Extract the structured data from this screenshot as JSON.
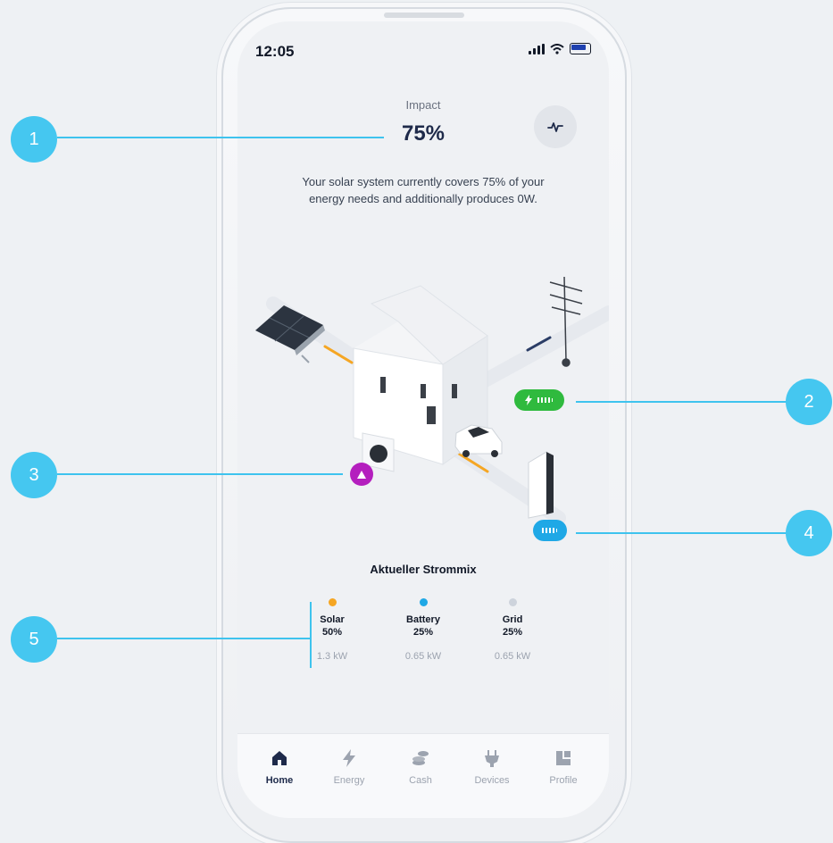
{
  "status": {
    "time": "12:05"
  },
  "impact": {
    "label": "Impact",
    "value": "75%",
    "description": "Your solar system currently covers 75% of your energy needs and additionally produces 0W."
  },
  "mix": {
    "title": "Aktueller Strommix",
    "items": [
      {
        "name": "Solar",
        "percent": "50%",
        "power": "1.3 kW",
        "color": "#f5a623"
      },
      {
        "name": "Battery",
        "percent": "25%",
        "power": "0.65 kW",
        "color": "#1fa8e6"
      },
      {
        "name": "Grid",
        "percent": "25%",
        "power": "0.65 kW",
        "color": "#cdd3dc"
      }
    ]
  },
  "tabs": [
    {
      "label": "Home",
      "icon": "home-icon",
      "active": true
    },
    {
      "label": "Energy",
      "icon": "lightning-icon",
      "active": false
    },
    {
      "label": "Cash",
      "icon": "coins-icon",
      "active": false
    },
    {
      "label": "Devices",
      "icon": "plug-icon",
      "active": false
    },
    {
      "label": "Profile",
      "icon": "profile-icon",
      "active": false
    }
  ],
  "callouts": [
    "1",
    "2",
    "3",
    "4",
    "5"
  ],
  "colors": {
    "accent": "#45c7f0",
    "grid_pill": "#2fba3e",
    "battery_pill": "#1fa8e6",
    "heatpump_dot": "#b41fbe",
    "text_dark": "#1e2a4a"
  }
}
